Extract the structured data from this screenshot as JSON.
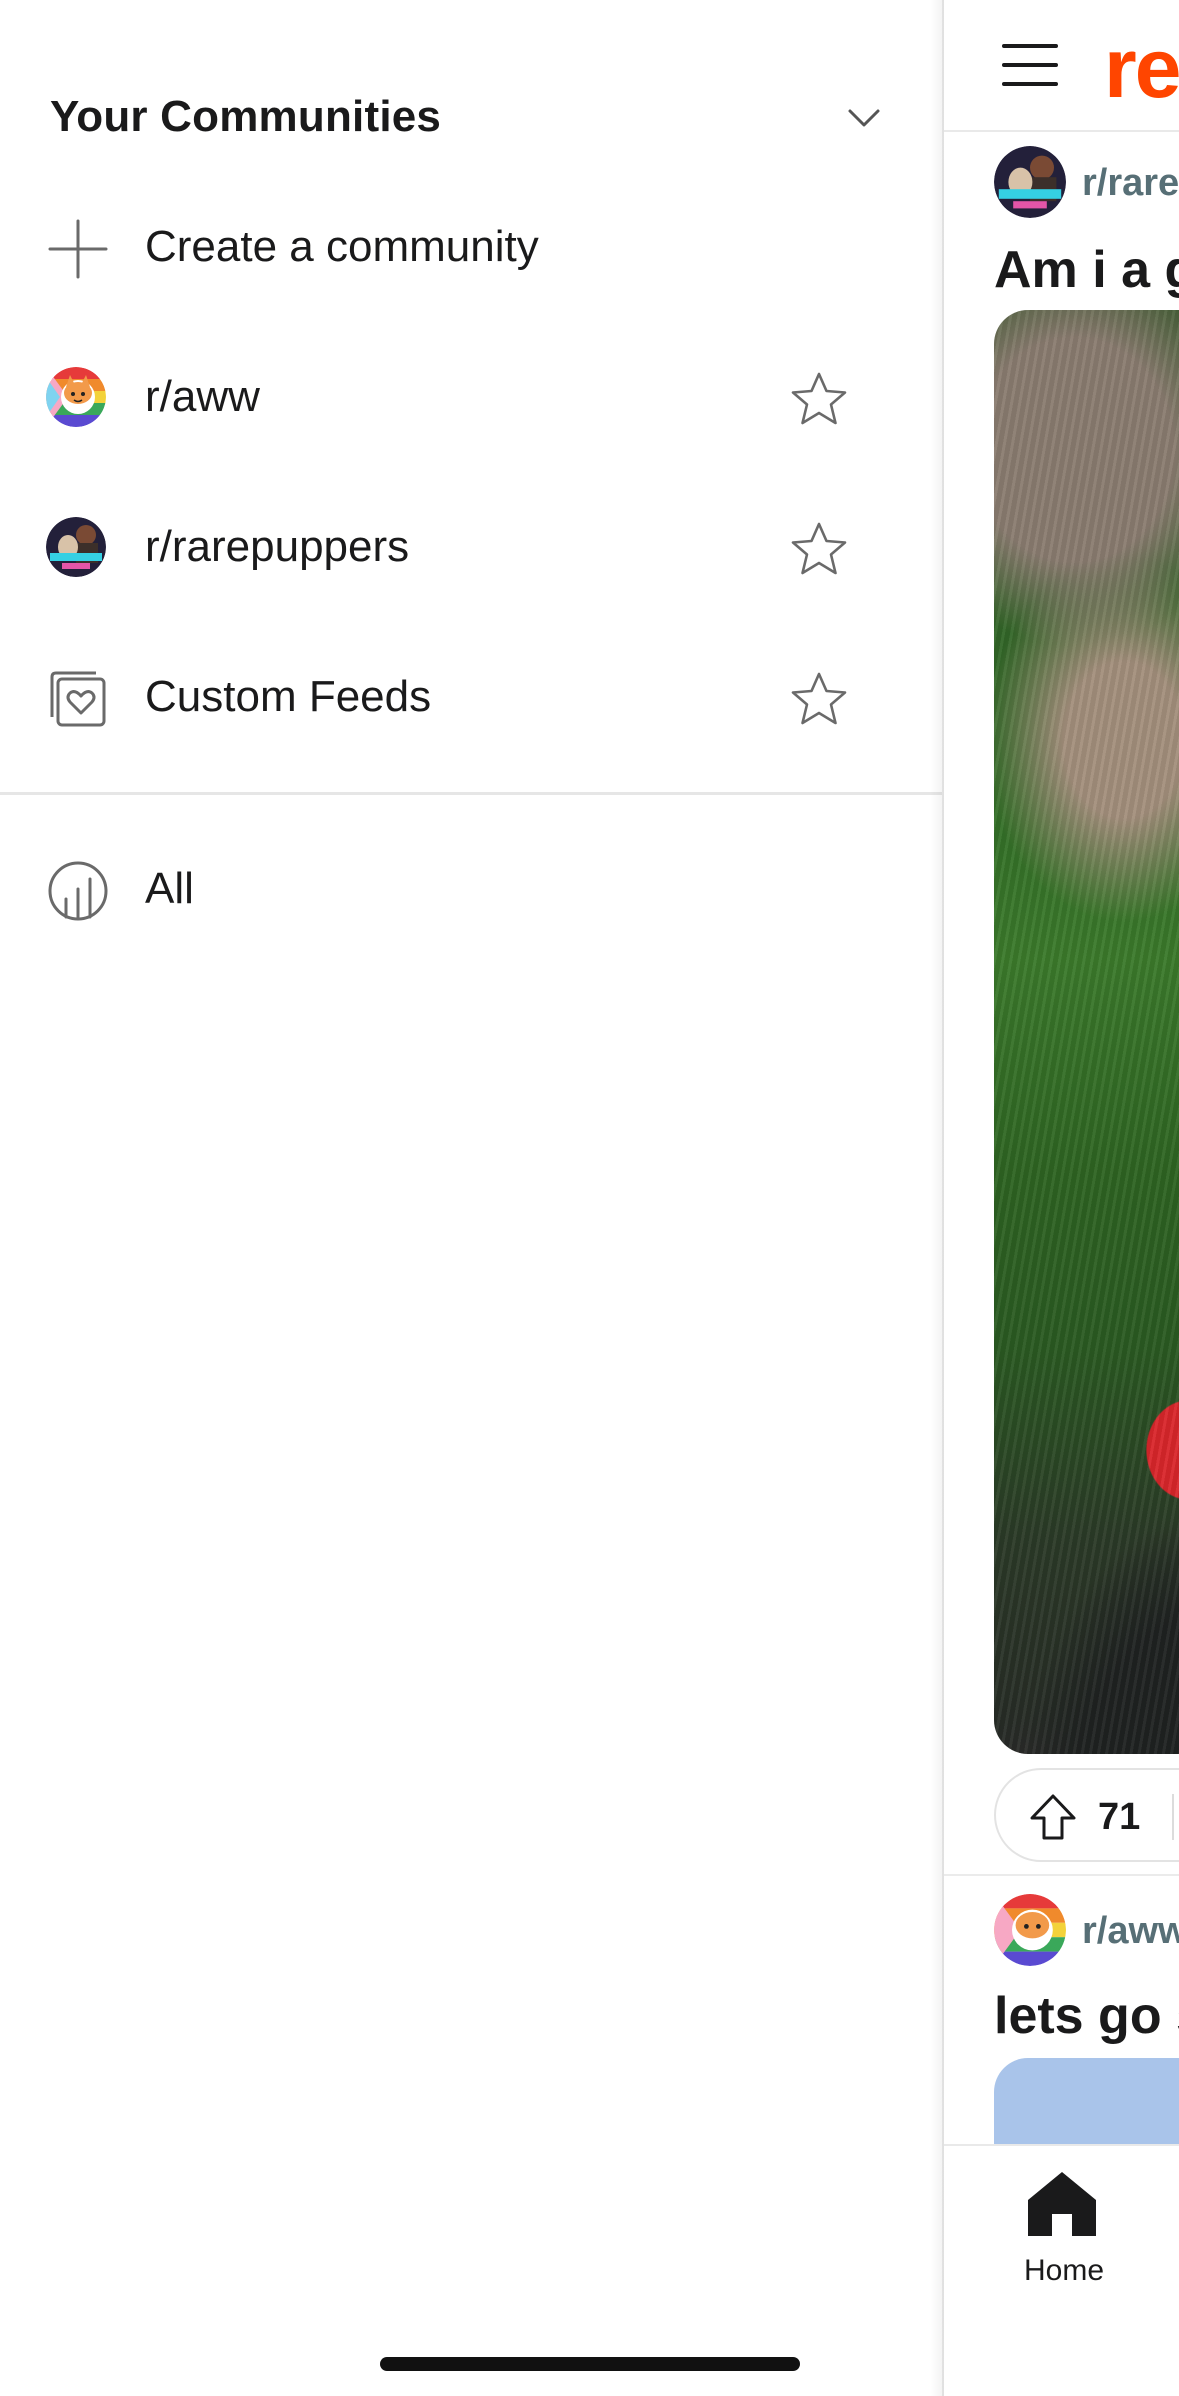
{
  "drawer": {
    "section_title": "Your Communities",
    "create_label": "Create a community",
    "items": [
      {
        "label": "r/aww",
        "icon": "aww-avatar"
      },
      {
        "label": "r/rarepuppers",
        "icon": "rarepuppers-avatar"
      },
      {
        "label": "Custom Feeds",
        "icon": "custom-feeds-icon"
      }
    ],
    "all_label": "All"
  },
  "feed": {
    "brand": "re",
    "posts": [
      {
        "subreddit": "r/rare",
        "title": "Am i a g",
        "upvotes": "71"
      },
      {
        "subreddit": "r/aww",
        "title": "lets go s"
      }
    ],
    "nav": {
      "home_label": "Home"
    }
  },
  "colors": {
    "brand": "#ff4500",
    "text": "#1a1a1b",
    "muted": "#576f76",
    "icon_stroke": "#6a6a6a"
  }
}
